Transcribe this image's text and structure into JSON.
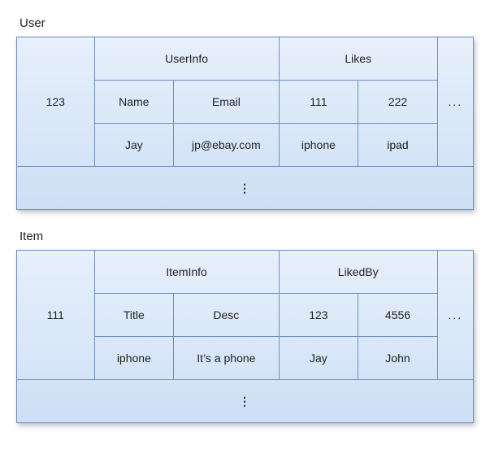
{
  "tables": [
    {
      "name": "User",
      "rowkey": "123",
      "families": [
        {
          "name": "UserInfo",
          "columns": [
            {
              "qualifier": "Name",
              "value": "Jay"
            },
            {
              "qualifier": "Email",
              "value": "jp@ebay.com"
            }
          ]
        },
        {
          "name": "Likes",
          "columns": [
            {
              "qualifier": "111",
              "value": "iphone"
            },
            {
              "qualifier": "222",
              "value": "ipad"
            }
          ]
        }
      ],
      "h_ellipsis": "...",
      "v_ellipsis": true
    },
    {
      "name": "Item",
      "rowkey": "111",
      "families": [
        {
          "name": "ItemInfo",
          "columns": [
            {
              "qualifier": "Title",
              "value": "iphone"
            },
            {
              "qualifier": "Desc",
              "value": "It’s a phone"
            }
          ]
        },
        {
          "name": "LikedBy",
          "columns": [
            {
              "qualifier": "123",
              "value": "Jay"
            },
            {
              "qualifier": "4556",
              "value": "John"
            }
          ]
        }
      ],
      "h_ellipsis": "...",
      "v_ellipsis": true
    }
  ]
}
